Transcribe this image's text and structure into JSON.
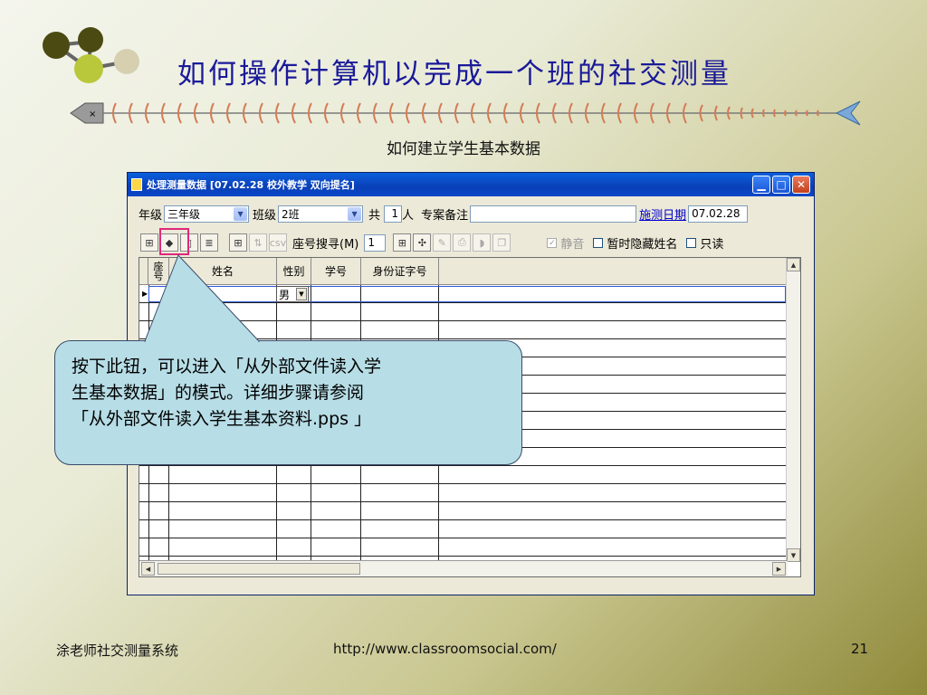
{
  "slide": {
    "title": "如何操作计算机以完成一个班的社交测量",
    "subtitle": "如何建立学生基本数据",
    "footer_left": "涂老师社交测量系统",
    "footer_center": "http://www.classroomsocial.com/",
    "page_number": "21"
  },
  "window": {
    "title": "处理测量数据 [07.02.28  校外教学  双向提名]",
    "grade_label": "年级",
    "grade_value": "三年级",
    "class_label": "班级",
    "class_value": "2班",
    "total_label": "共",
    "total_value": "1",
    "person_label": "人",
    "note_label": "专案备注",
    "note_value": "",
    "date_label": "施测日期",
    "date_value": "07.02.28",
    "seat_search_label": "座号搜寻(M)",
    "seat_search_value": "1",
    "mute_label": "静音",
    "hide_names_label": "暂时隐藏姓名",
    "readonly_label": "只读"
  },
  "grid": {
    "columns": [
      "座号",
      "姓名",
      "性别",
      "学号",
      "身份证字号"
    ],
    "rows": [
      {
        "seat": "",
        "name": "",
        "gender": "男",
        "student_id": "",
        "id_number": ""
      }
    ]
  },
  "callout": {
    "line1": "按下此钮，可以进入「从外部文件读入学",
    "line2": "生基本数据」的模式。详细步骤请参阅",
    "line3": "「从外部文件读入学生基本资料.pps 」"
  },
  "colors": {
    "title_blue": "#1a1a99",
    "titlebar_blue": "#0a4fd0",
    "callout_fill": "#b7dde6",
    "highlight_pink": "#e0297a"
  }
}
